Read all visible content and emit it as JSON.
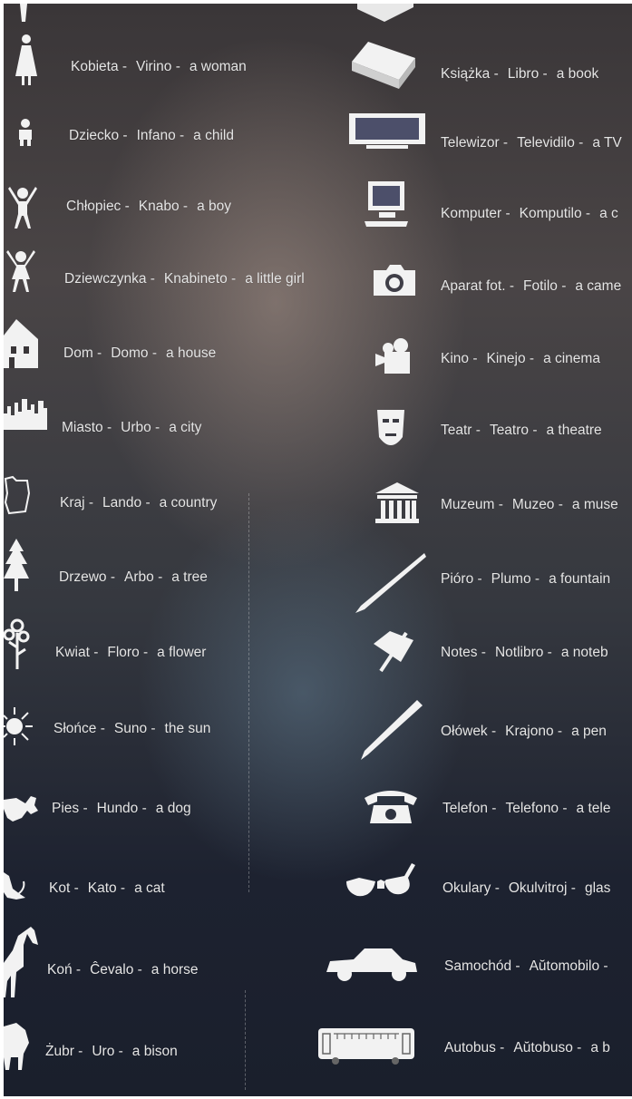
{
  "left_column": [
    {
      "polish": "Kobieta -",
      "esperanto": "Virino -",
      "english": "a woman",
      "icon": "woman-icon"
    },
    {
      "polish": "Dziecko -",
      "esperanto": "Infano -",
      "english": "a child",
      "icon": "child-icon"
    },
    {
      "polish": "Chłopiec -",
      "esperanto": "Knabo -",
      "english": "a boy",
      "icon": "boy-icon"
    },
    {
      "polish": "Dziewczynka -",
      "esperanto": "Knabineto -",
      "english": "a little girl",
      "icon": "girl-icon"
    },
    {
      "polish": "Dom -",
      "esperanto": "Domo -",
      "english": "a house",
      "icon": "house-icon"
    },
    {
      "polish": "Miasto -",
      "esperanto": "Urbo -",
      "english": "a city",
      "icon": "city-icon"
    },
    {
      "polish": "Kraj -",
      "esperanto": "Lando -",
      "english": "a country",
      "icon": "country-icon"
    },
    {
      "polish": "Drzewo -",
      "esperanto": "Arbo -",
      "english": "a tree",
      "icon": "tree-icon"
    },
    {
      "polish": "Kwiat -",
      "esperanto": "Floro -",
      "english": "a flower",
      "icon": "flower-icon"
    },
    {
      "polish": "Słońce -",
      "esperanto": "Suno -",
      "english": "the sun",
      "icon": "sun-icon"
    },
    {
      "polish": "Pies -",
      "esperanto": "Hundo -",
      "english": "a dog",
      "icon": "dog-icon"
    },
    {
      "polish": "Kot -",
      "esperanto": "Kato -",
      "english": "a cat",
      "icon": "cat-icon"
    },
    {
      "polish": "Koń -",
      "esperanto": "Ĉevalo -",
      "english": "a horse",
      "icon": "horse-icon"
    },
    {
      "polish": "Żubr -",
      "esperanto": "Uro -",
      "english": "a bison",
      "icon": "bison-icon"
    }
  ],
  "right_column": [
    {
      "polish": "Książka -",
      "esperanto": "Libro -",
      "english": "a book",
      "icon": "book-icon"
    },
    {
      "polish": "Telewizor -",
      "esperanto": "Televidilo -",
      "english": "a TV",
      "icon": "tv-icon"
    },
    {
      "polish": "Komputer -",
      "esperanto": "Komputilo -",
      "english": "a c",
      "icon": "computer-icon"
    },
    {
      "polish": "Aparat fot. -",
      "esperanto": "Fotilo -",
      "english": "a came",
      "icon": "camera-icon"
    },
    {
      "polish": "Kino -",
      "esperanto": "Kinejo -",
      "english": "a cinema",
      "icon": "cinema-icon"
    },
    {
      "polish": "Teatr -",
      "esperanto": "Teatro -",
      "english": "a theatre",
      "icon": "theatre-mask-icon"
    },
    {
      "polish": "Muzeum -",
      "esperanto": "Muzeo -",
      "english": "a muse",
      "icon": "museum-icon"
    },
    {
      "polish": "Pióro -",
      "esperanto": "Plumo -",
      "english": "a fountain",
      "icon": "fountain-pen-icon"
    },
    {
      "polish": "Notes -",
      "esperanto": "Notlibro -",
      "english": "a noteb",
      "icon": "notebook-icon"
    },
    {
      "polish": "Ołówek -",
      "esperanto": "Krajono -",
      "english": "a pen",
      "icon": "pencil-icon"
    },
    {
      "polish": "Telefon -",
      "esperanto": "Telefono -",
      "english": "a tele",
      "icon": "telephone-icon"
    },
    {
      "polish": "Okulary -",
      "esperanto": "Okulvitroj -",
      "english": "glas",
      "icon": "glasses-icon"
    },
    {
      "polish": "Samochód -",
      "esperanto": "Aŭtomobilo -",
      "english": "",
      "icon": "car-icon"
    },
    {
      "polish": "Autobus -",
      "esperanto": "Aŭtobuso -",
      "english": "a b",
      "icon": "bus-icon"
    }
  ],
  "colors": {
    "text": "#e6e6e6",
    "icon": "#f2f2f2",
    "background": "#2e2e33"
  }
}
